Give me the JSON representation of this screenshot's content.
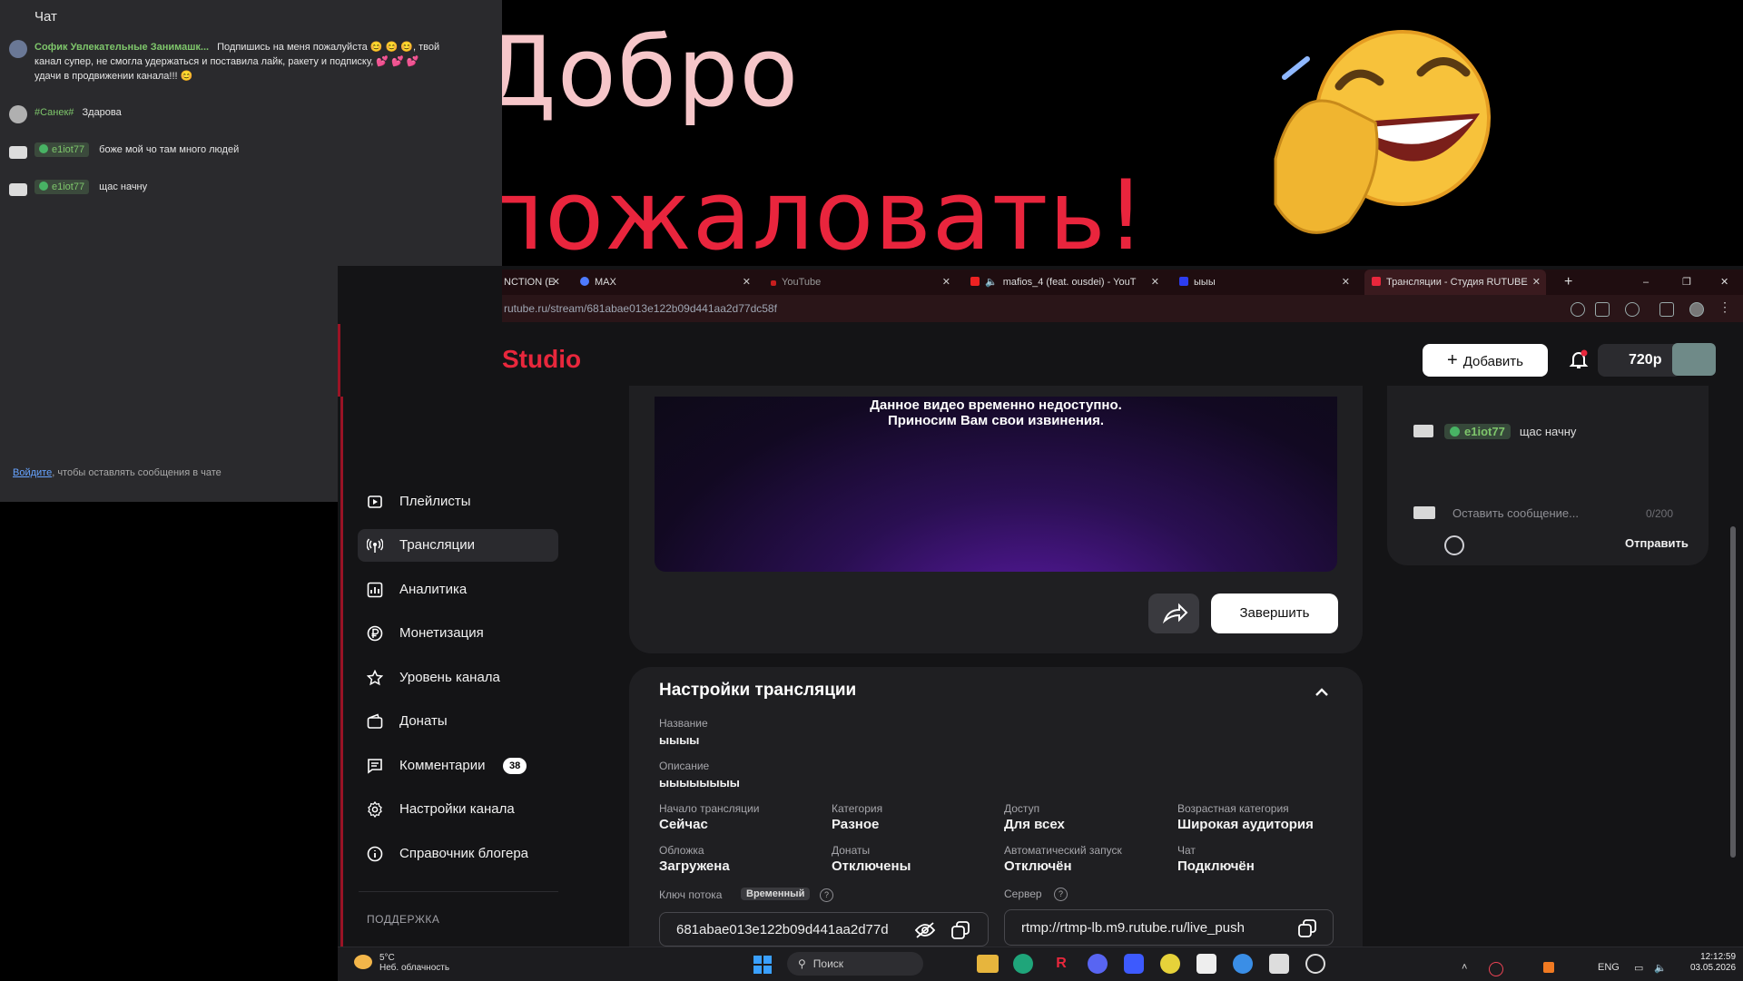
{
  "overlay": {
    "welcome_line1": "Добро",
    "welcome_line2": "пожаловать!"
  },
  "chat_overlay": {
    "title": "Чат",
    "messages": [
      {
        "author": "Софик Увлекательные Занимашк...",
        "text": "Подпишись на меня пожалуйста 😊 😊 😊, твой канал супер, не смогла удержаться и поставила лайк, ракету и подписку, 💕 💕 💕 удачи в продвижении канала!!! 😊"
      },
      {
        "author": "#Санек#",
        "text": "Здарова"
      },
      {
        "author": "e1iot77",
        "text": "боже мой чо там много людей"
      },
      {
        "author": "e1iot77",
        "text": "щас начну"
      }
    ],
    "login_link": "Войдите",
    "login_text": ", чтобы оставлять сообщения в чате"
  },
  "browser": {
    "tabs": [
      {
        "label": "NCTION (E",
        "active": false
      },
      {
        "label": "MAX",
        "active": false
      },
      {
        "label": "YouTube",
        "active": false
      },
      {
        "label": "mafios_4 (feat. ousdei) - YouT",
        "active": false
      },
      {
        "label": "ыыы",
        "active": false
      },
      {
        "label": "Трансляции - Студия RUTUBE",
        "active": true
      }
    ],
    "new_tab": "+",
    "url": "rutube.ru/stream/681abae013e122b09d441aa2d77dc58f"
  },
  "header": {
    "logo": "Studio",
    "add_label": "Добавить",
    "quality": "720p"
  },
  "sidebar": {
    "items": [
      {
        "label": "Плейлисты",
        "icon": "playlist-icon"
      },
      {
        "label": "Трансляции",
        "icon": "broadcast-icon",
        "active": true
      },
      {
        "label": "Аналитика",
        "icon": "analytics-icon"
      },
      {
        "label": "Монетизация",
        "icon": "ruble-icon"
      },
      {
        "label": "Уровень канала",
        "icon": "star-icon"
      },
      {
        "label": "Донаты",
        "icon": "wallet-icon"
      },
      {
        "label": "Комментарии",
        "icon": "comment-icon",
        "count": "38"
      },
      {
        "label": "Настройки канала",
        "icon": "gear-icon"
      },
      {
        "label": "Справочник блогера",
        "icon": "info-icon"
      }
    ],
    "support_title": "ПОДДЕРЖКА"
  },
  "player": {
    "message_line1": "Данное видео временно недоступно.",
    "message_line2": "Приносим Вам свои извинения.",
    "finish_label": "Завершить"
  },
  "settings": {
    "title": "Настройки трансляции",
    "name_label": "Название",
    "name_value": "ыыыы",
    "desc_label": "Описание",
    "desc_value": "ыыыыыыыы",
    "fields": [
      {
        "label": "Начало трансляции",
        "value": "Сейчас"
      },
      {
        "label": "Категория",
        "value": "Разное"
      },
      {
        "label": "Доступ",
        "value": "Для всех"
      },
      {
        "label": "Возрастная категория",
        "value": "Широкая аудитория"
      },
      {
        "label": "Обложка",
        "value": "Загружена"
      },
      {
        "label": "Донаты",
        "value": "Отключены"
      },
      {
        "label": "Автоматический запуск",
        "value": "Отключён"
      },
      {
        "label": "Чат",
        "value": "Подключён"
      }
    ],
    "key_label": "Ключ потока",
    "key_tag": "Временный",
    "key_value": "681abae013e122b09d441aa2d77d",
    "server_label": "Сервер",
    "server_value": "rtmp://rtmp-lb.m9.rutube.ru/live_push"
  },
  "right_chat": {
    "author": "e1iot77",
    "text": "щас начну",
    "input_placeholder": "Оставить сообщение...",
    "count": "0/200",
    "send_label": "Отправить"
  },
  "taskbar": {
    "temp": "5°C",
    "weather": "Неб. облачность",
    "search": "Поиск",
    "lang": "ENG",
    "time": "12:12:59",
    "date": "03.05.2026"
  },
  "colors": {
    "brand_red": "#e8273c",
    "accent_green": "#7ec66b"
  }
}
